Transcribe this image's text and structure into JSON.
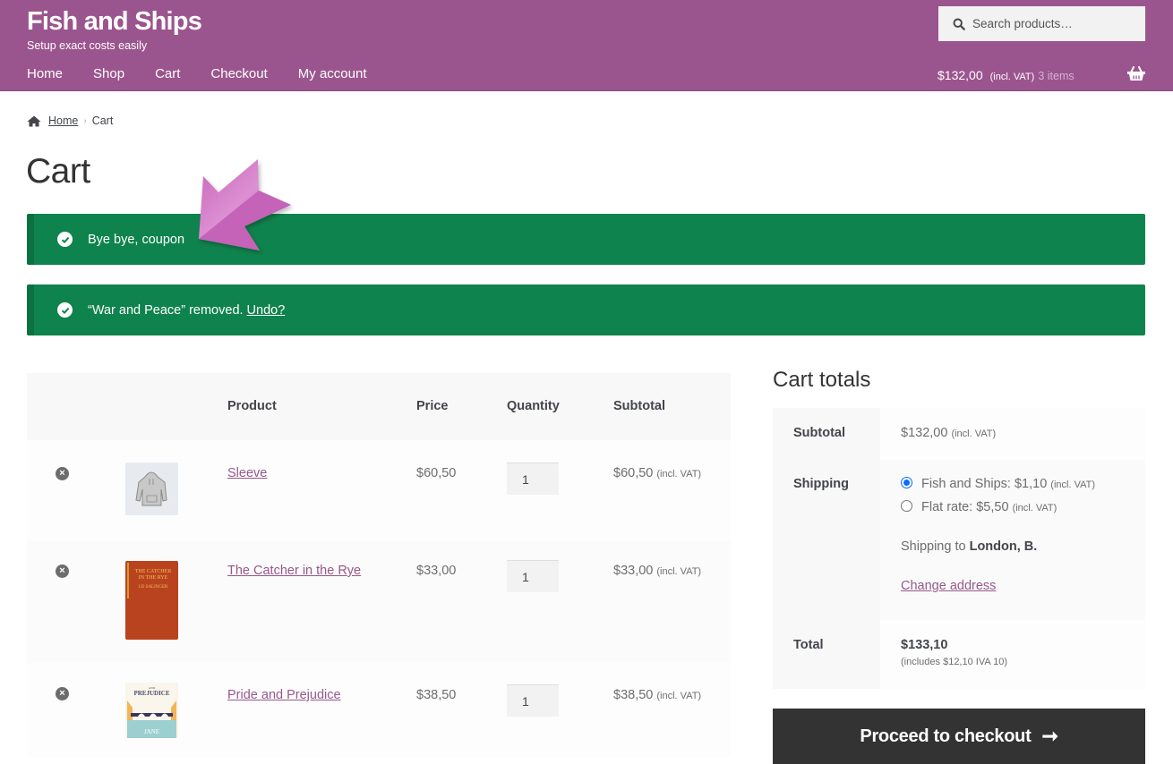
{
  "header": {
    "site_title": "Fish and Ships",
    "tagline": "Setup exact costs easily",
    "search_placeholder": "Search products…",
    "nav": [
      "Home",
      "Shop",
      "Cart",
      "Checkout",
      "My account"
    ],
    "mini_cart": {
      "amount": "$132,00",
      "tax_label": "(incl. VAT)",
      "items": "3 items"
    },
    "brand_color": "#9b558e"
  },
  "breadcrumb": {
    "home": "Home",
    "current": "Cart"
  },
  "page_title": "Cart",
  "notices": [
    {
      "text": "Bye bye, coupon",
      "link": ""
    },
    {
      "text": "“War and Peace” removed.",
      "link": "Undo?"
    }
  ],
  "cart": {
    "columns": [
      "",
      "",
      "Product",
      "Price",
      "Quantity",
      "Subtotal"
    ],
    "rows": [
      {
        "product": "Sleeve",
        "price": "$60,50",
        "quantity": "1",
        "subtotal": "$60,50",
        "tax_label": "(incl. VAT)",
        "thumb": "hoodie"
      },
      {
        "product": "The Catcher in the Rye",
        "price": "$33,00",
        "quantity": "1",
        "subtotal": "$33,00",
        "tax_label": "(incl. VAT)",
        "thumb": "catcher-book"
      },
      {
        "product": "Pride and Prejudice",
        "price": "$38,50",
        "quantity": "1",
        "subtotal": "$38,50",
        "tax_label": "(incl. VAT)",
        "thumb": "pride-book"
      }
    ]
  },
  "totals": {
    "title": "Cart totals",
    "subtotal_label": "Subtotal",
    "subtotal_value": "$132,00",
    "subtotal_tax": "(incl. VAT)",
    "shipping_label": "Shipping",
    "shipping_options": [
      {
        "label": "Fish and Ships: $1,10",
        "tax": "(incl. VAT)",
        "selected": true
      },
      {
        "label": "Flat rate: $5,50",
        "tax": "(incl. VAT)",
        "selected": false
      }
    ],
    "shipping_to_prefix": "Shipping to",
    "shipping_to_place": "London, B.",
    "change_address": "Change address",
    "total_label": "Total",
    "total_value": "$133,10",
    "total_tax_note": "(includes $12,10 IVA 10)",
    "checkout_button": "Proceed to checkout",
    "checkout_arrow": "➞"
  },
  "colors": {
    "notice_green": "#0f834d",
    "link_purple": "#96588a",
    "button_dark": "#333333"
  }
}
